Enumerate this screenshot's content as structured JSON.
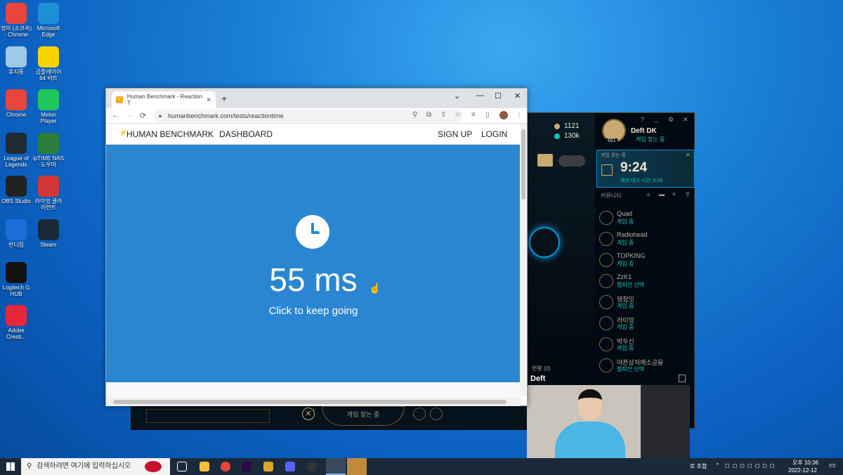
{
  "desktop": {
    "icons": [
      {
        "label": "정미 (소코속) - Chrome",
        "color": "#e8453c"
      },
      {
        "label": "Microsoft Edge",
        "color": "#1d8fd6"
      },
      {
        "label": "휴지통",
        "color": "#9ec9e8"
      },
      {
        "label": "곰플레이어 64 비트",
        "color": "#f7d400"
      },
      {
        "label": "Chrome",
        "color": "#e8453c"
      },
      {
        "label": "Melon Player",
        "color": "#1fc65c"
      },
      {
        "label": "League of Legends",
        "color": "#1f2a33"
      },
      {
        "label": "ipTIME NAS 도우미",
        "color": "#2f7d3a"
      },
      {
        "label": "OBS Studio",
        "color": "#222"
      },
      {
        "label": "라이엇 클라이언트",
        "color": "#d13639"
      },
      {
        "label": "반디집",
        "color": "#1a6ed8"
      },
      {
        "label": "Steam",
        "color": "#1b2838"
      },
      {
        "label": "Logitech G HUB",
        "color": "#111"
      },
      {
        "label": "Adobe Creati...",
        "color": "#e8253a"
      }
    ]
  },
  "browser": {
    "tab_title": "Human Benchmark - Reaction T",
    "url": "humanbenchmark.com/tests/reactiontime",
    "header": {
      "brand": "HUMAN BENCHMARK",
      "dashboard": "DASHBOARD",
      "signup": "SIGN UP",
      "login": "LOGIN"
    },
    "result": "55 ms",
    "subtitle": "Click to keep going"
  },
  "lol": {
    "currency_rp": "1121",
    "currency_be": "130k",
    "profile_name": "Deft DK",
    "profile_status": "게임 찾는 중",
    "level": "651",
    "queue_label": "게임 찾는 중",
    "timer": "9:24",
    "estimate": "예상 대기 시간: 3:29",
    "community_label": "커뮤니티",
    "friends": [
      {
        "name": "Quad",
        "status": "게임 중"
      },
      {
        "name": "Radiohead",
        "status": "게임 중"
      },
      {
        "name": "TOPKING",
        "status": "게임 중"
      },
      {
        "name": "ZzK1",
        "status": "챔피언 선택"
      },
      {
        "name": "댕청잇",
        "status": "게임 중"
      },
      {
        "name": "라이엉",
        "status": "게임 중"
      },
      {
        "name": "박두신",
        "status": "게임 중"
      },
      {
        "name": "야픈상처에소금을",
        "status": "챔피언 선택"
      }
    ],
    "status_count": "현황 (0)",
    "bottom_finding": "게임 찾는 중"
  },
  "webcam": {
    "name": "Deft"
  },
  "taskbar": {
    "search_placeholder": "검색하려면 여기에 입력하십시오",
    "ime": "로 조합",
    "time": "오후 10:36",
    "date": "2022-12-12"
  }
}
